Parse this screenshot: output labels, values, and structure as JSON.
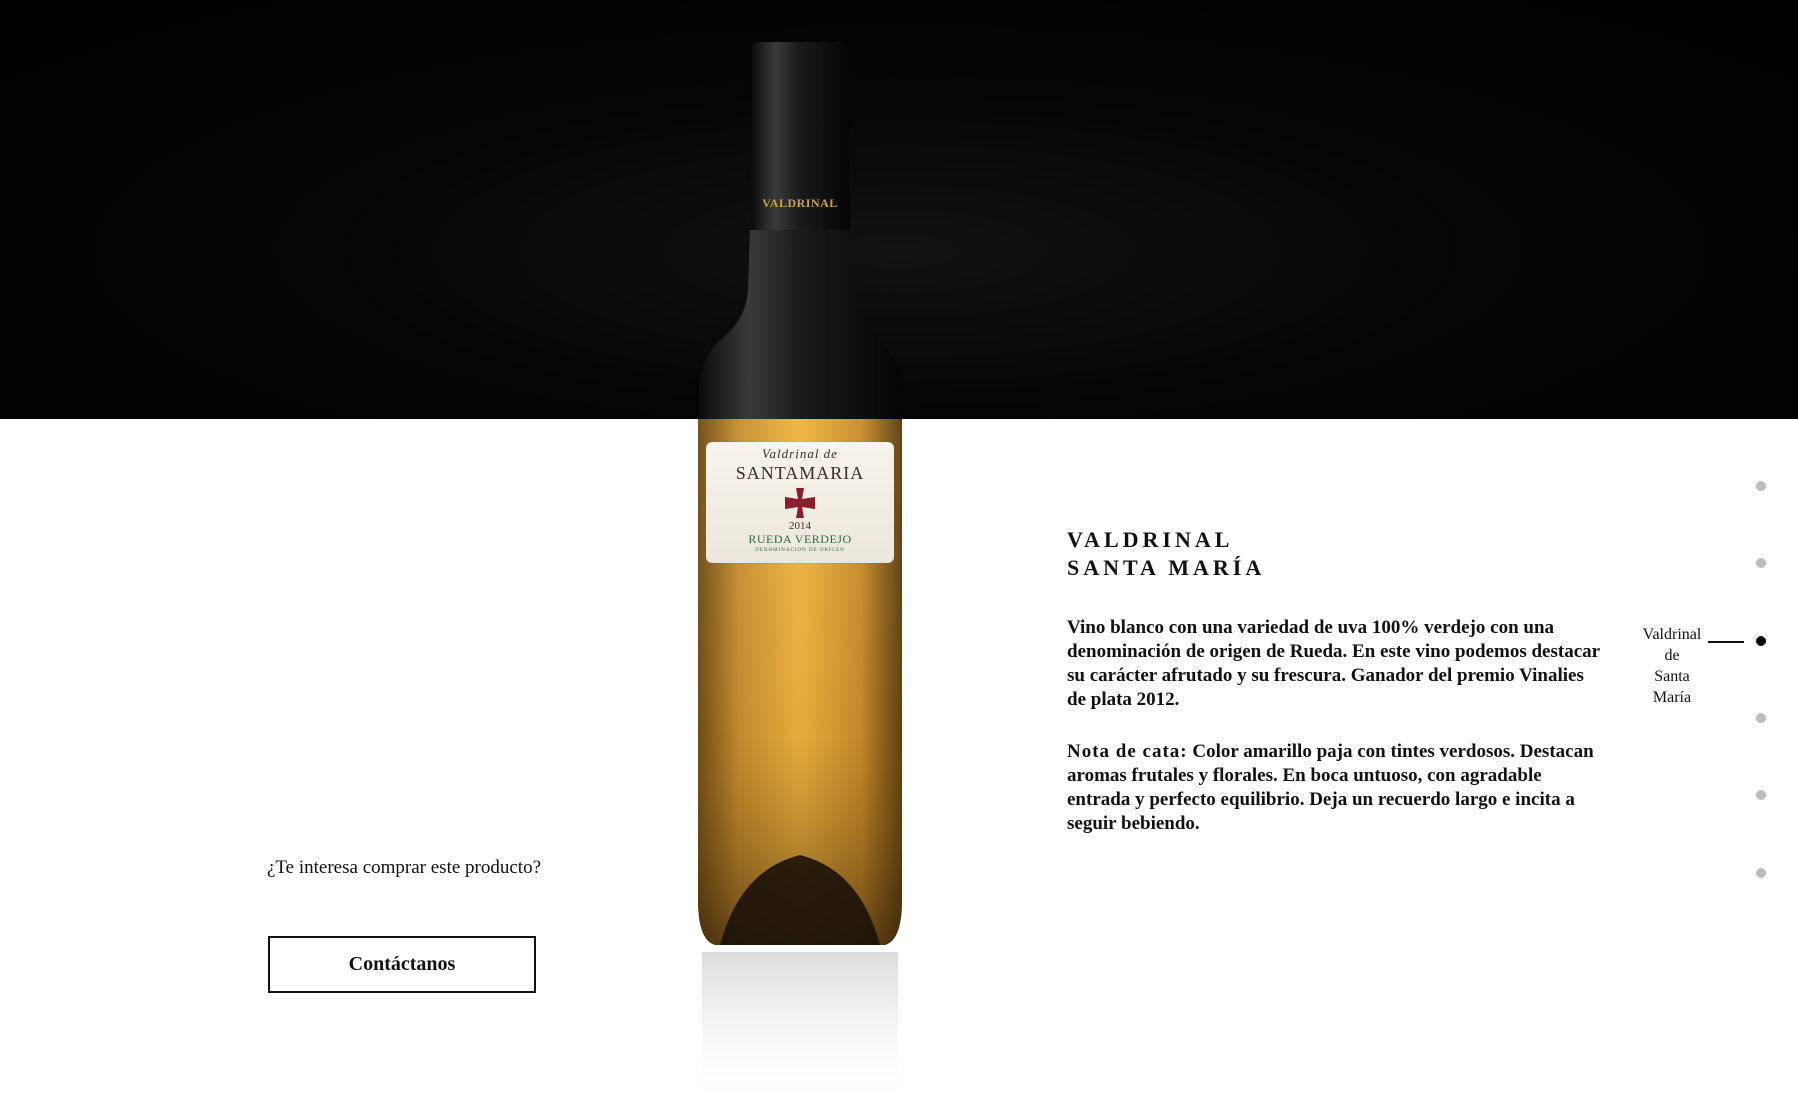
{
  "product": {
    "title_line1": "VALDRINAL",
    "title_line2": "SANTA MARÍA",
    "description": "Vino blanco con una variedad de uva 100% verdejo con una denominación de origen de Rueda. En este vino podemos destacar su carácter afrutado y su frescura. Ganador del premio Vinalies de plata 2012.",
    "tasting_label": "Nota de cata:",
    "tasting_text": "Color amarillo paja con tintes verdosos. Destacan aromas frutales y florales. En boca untuoso, con agradable entrada y perfecto equilibrio. Deja un recuerdo largo e incita a seguir bebiendo."
  },
  "bottle_label": {
    "neck_brand": "VALDRINAL",
    "script": "Valdrinal de",
    "brand": "SANTAMARIA",
    "year": "2014",
    "type": "RUEDA VERDEJO",
    "denomination": "DENOMINACION DE ORIGEN"
  },
  "cta": {
    "question": "¿Te interesa comprar este producto?",
    "button_label": "Contáctanos"
  },
  "side_nav": {
    "active_label_line1": "Valdrinal",
    "active_label_line2": "de",
    "active_label_line3": "Santa",
    "active_label_line4": "María",
    "dot_count": 6,
    "active_index": 2
  },
  "colors": {
    "top_band": "#000000",
    "background": "#ffffff",
    "wine": "#e0a23a",
    "glass": "#1a1a1a",
    "cross": "#8c1f2c",
    "label_green": "#2c6b3f",
    "dot_inactive": "#bdbdbd",
    "dot_active": "#000000"
  }
}
